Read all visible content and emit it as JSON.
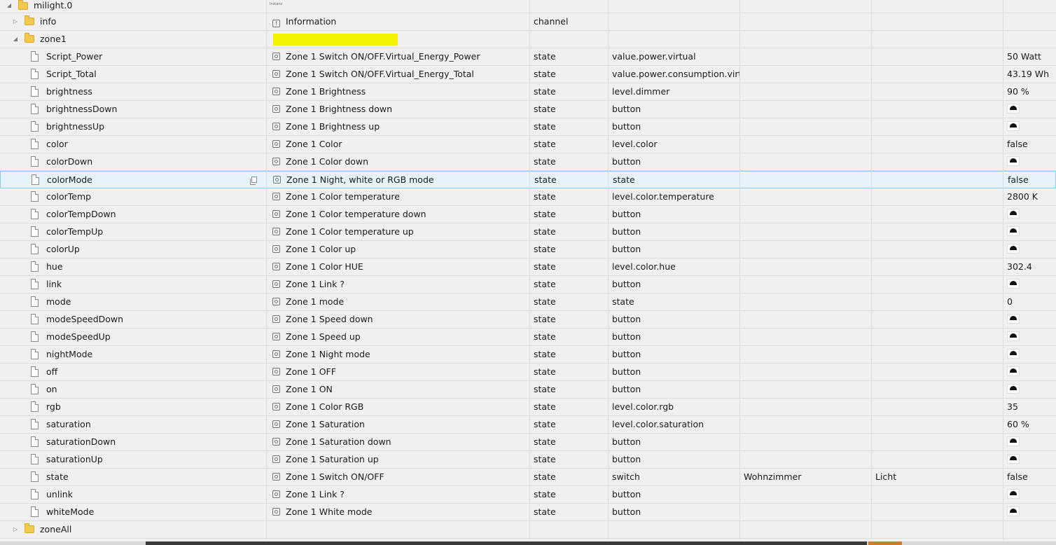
{
  "tree": {
    "root": {
      "name": "milight.0",
      "desc": "Instanz"
    },
    "info": {
      "name": "info",
      "desc": "Information",
      "type": "channel"
    },
    "zone1": {
      "name": "zone1"
    },
    "zoneAll": {
      "name": "zoneAll"
    },
    "states": [
      {
        "name": "Script_Power",
        "desc": "Zone 1 Switch ON/OFF.Virtual_Energy_Power",
        "type": "state",
        "role": "value.power.virtual",
        "room": "",
        "func": "",
        "value": "50 Watt"
      },
      {
        "name": "Script_Total",
        "desc": "Zone 1 Switch ON/OFF.Virtual_Energy_Total",
        "type": "state",
        "role": "value.power.consumption.virtua",
        "room": "",
        "func": "",
        "value": "43.19 Wh"
      },
      {
        "name": "brightness",
        "desc": "Zone 1 Brightness",
        "type": "state",
        "role": "level.dimmer",
        "room": "",
        "func": "",
        "value": "90 %"
      },
      {
        "name": "brightnessDown",
        "desc": "Zone 1 Brightness down",
        "type": "state",
        "role": "button",
        "room": "",
        "func": "",
        "value": ""
      },
      {
        "name": "brightnessUp",
        "desc": "Zone 1 Brightness up",
        "type": "state",
        "role": "button",
        "room": "",
        "func": "",
        "value": ""
      },
      {
        "name": "color",
        "desc": "Zone 1 Color",
        "type": "state",
        "role": "level.color",
        "room": "",
        "func": "",
        "value": "false"
      },
      {
        "name": "colorDown",
        "desc": "Zone 1 Color down",
        "type": "state",
        "role": "button",
        "room": "",
        "func": "",
        "value": ""
      },
      {
        "name": "colorMode",
        "desc": "Zone 1 Night, white or RGB mode",
        "type": "state",
        "role": "state",
        "room": "",
        "func": "",
        "value": "false"
      },
      {
        "name": "colorTemp",
        "desc": "Zone 1 Color temperature",
        "type": "state",
        "role": "level.color.temperature",
        "room": "",
        "func": "",
        "value": "2800 K"
      },
      {
        "name": "colorTempDown",
        "desc": "Zone 1 Color temperature down",
        "type": "state",
        "role": "button",
        "room": "",
        "func": "",
        "value": ""
      },
      {
        "name": "colorTempUp",
        "desc": "Zone 1 Color temperature up",
        "type": "state",
        "role": "button",
        "room": "",
        "func": "",
        "value": ""
      },
      {
        "name": "colorUp",
        "desc": "Zone 1 Color up",
        "type": "state",
        "role": "button",
        "room": "",
        "func": "",
        "value": ""
      },
      {
        "name": "hue",
        "desc": "Zone 1 Color HUE",
        "type": "state",
        "role": "level.color.hue",
        "room": "",
        "func": "",
        "value": "302.4"
      },
      {
        "name": "link",
        "desc": "Zone 1 Link ?",
        "type": "state",
        "role": "button",
        "room": "",
        "func": "",
        "value": ""
      },
      {
        "name": "mode",
        "desc": "Zone 1 mode",
        "type": "state",
        "role": "state",
        "room": "",
        "func": "",
        "value": "0"
      },
      {
        "name": "modeSpeedDown",
        "desc": "Zone 1 Speed down",
        "type": "state",
        "role": "button",
        "room": "",
        "func": "",
        "value": ""
      },
      {
        "name": "modeSpeedUp",
        "desc": "Zone 1 Speed up",
        "type": "state",
        "role": "button",
        "room": "",
        "func": "",
        "value": ""
      },
      {
        "name": "nightMode",
        "desc": "Zone 1 Night mode",
        "type": "state",
        "role": "button",
        "room": "",
        "func": "",
        "value": ""
      },
      {
        "name": "off",
        "desc": "Zone 1 OFF",
        "type": "state",
        "role": "button",
        "room": "",
        "func": "",
        "value": ""
      },
      {
        "name": "on",
        "desc": "Zone 1 ON",
        "type": "state",
        "role": "button",
        "room": "",
        "func": "",
        "value": ""
      },
      {
        "name": "rgb",
        "desc": "Zone 1 Color RGB",
        "type": "state",
        "role": "level.color.rgb",
        "room": "",
        "func": "",
        "value": "35"
      },
      {
        "name": "saturation",
        "desc": "Zone 1 Saturation",
        "type": "state",
        "role": "level.color.saturation",
        "room": "",
        "func": "",
        "value": "60 %"
      },
      {
        "name": "saturationDown",
        "desc": "Zone 1 Saturation down",
        "type": "state",
        "role": "button",
        "room": "",
        "func": "",
        "value": ""
      },
      {
        "name": "saturationUp",
        "desc": "Zone 1 Saturation up",
        "type": "state",
        "role": "button",
        "room": "",
        "func": "",
        "value": ""
      },
      {
        "name": "state",
        "desc": "Zone 1 Switch ON/OFF",
        "type": "state",
        "role": "switch",
        "room": "Wohnzimmer",
        "func": "Licht",
        "value": "false"
      },
      {
        "name": "unlink",
        "desc": "Zone 1 Link ?",
        "type": "state",
        "role": "button",
        "room": "",
        "func": "",
        "value": ""
      },
      {
        "name": "whiteMode",
        "desc": "Zone 1 White mode",
        "type": "state",
        "role": "button",
        "room": "",
        "func": "",
        "value": ""
      }
    ]
  },
  "selected_state": "colorMode",
  "colors": {
    "selected_bg": "#e6f3fb",
    "selected_border": "#8ec8ea",
    "redaction": "#f3f300",
    "folder": "#f2c94c"
  }
}
